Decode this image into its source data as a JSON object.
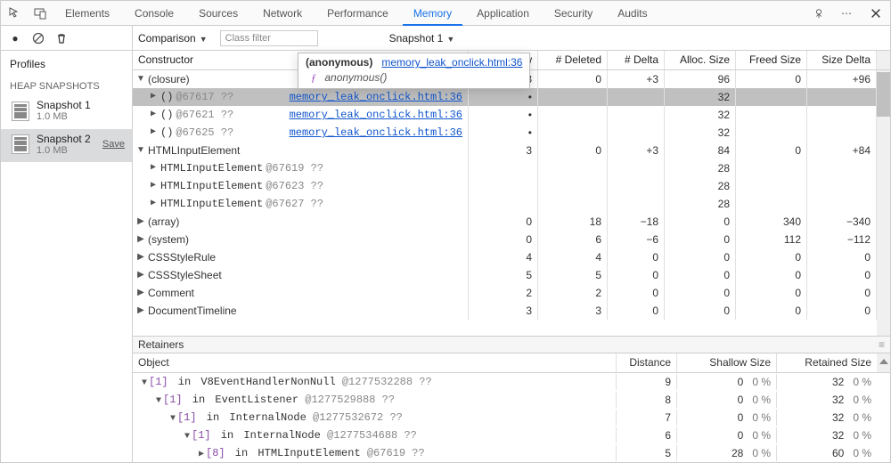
{
  "tabs": {
    "elements": "Elements",
    "console": "Console",
    "sources": "Sources",
    "network": "Network",
    "performance": "Performance",
    "memory": "Memory",
    "application": "Application",
    "security": "Security",
    "audits": "Audits"
  },
  "sidebar": {
    "profiles": "Profiles",
    "section": "HEAP SNAPSHOTS",
    "items": [
      {
        "name": "Snapshot 1",
        "size": "1.0 MB",
        "save": ""
      },
      {
        "name": "Snapshot 2",
        "size": "1.0 MB",
        "save": "Save"
      }
    ]
  },
  "filter": {
    "mode": "Comparison",
    "class_placeholder": "Class filter",
    "baseline": "Snapshot 1"
  },
  "headers": {
    "constructor": "Constructor",
    "new": "# New",
    "deleted": "# Deleted",
    "delta": "# Delta",
    "alloc": "Alloc. Size",
    "freed": "Freed Size",
    "sizedelta": "Size Delta"
  },
  "tooltip": {
    "name": "(anonymous)",
    "link": "memory_leak_onclick.html:36",
    "fn": "anonymous()"
  },
  "rows": [
    {
      "indent": 1,
      "open": true,
      "label": "(closure)",
      "addr": "",
      "rlink": "",
      "new": "3",
      "del": "0",
      "delta": "+3",
      "alloc": "96",
      "freed": "0",
      "sizedelta": "+96",
      "hl": false,
      "mono": false
    },
    {
      "indent": 2,
      "open": false,
      "label": "()",
      "addr": " @67617 ??",
      "rlink": "memory_leak_onclick.html:36",
      "new": "•",
      "del": "",
      "delta": "",
      "alloc": "32",
      "freed": "",
      "sizedelta": "",
      "hl": true,
      "mono": true
    },
    {
      "indent": 2,
      "open": false,
      "label": "()",
      "addr": " @67621 ??",
      "rlink": "memory_leak_onclick.html:36",
      "new": "•",
      "del": "",
      "delta": "",
      "alloc": "32",
      "freed": "",
      "sizedelta": "",
      "hl": false,
      "mono": true
    },
    {
      "indent": 2,
      "open": false,
      "label": "()",
      "addr": " @67625 ??",
      "rlink": "memory_leak_onclick.html:36",
      "new": "•",
      "del": "",
      "delta": "",
      "alloc": "32",
      "freed": "",
      "sizedelta": "",
      "hl": false,
      "mono": true
    },
    {
      "indent": 1,
      "open": true,
      "label": "HTMLInputElement",
      "addr": "",
      "rlink": "",
      "new": "3",
      "del": "0",
      "delta": "+3",
      "alloc": "84",
      "freed": "0",
      "sizedelta": "+84",
      "hl": false,
      "mono": false
    },
    {
      "indent": 2,
      "open": false,
      "label": "HTMLInputElement",
      "addr": " @67619 ??",
      "rlink": "",
      "new": "",
      "del": "",
      "delta": "",
      "alloc": "28",
      "freed": "",
      "sizedelta": "",
      "hl": false,
      "mono": true
    },
    {
      "indent": 2,
      "open": false,
      "label": "HTMLInputElement",
      "addr": " @67623 ??",
      "rlink": "",
      "new": "",
      "del": "",
      "delta": "",
      "alloc": "28",
      "freed": "",
      "sizedelta": "",
      "hl": false,
      "mono": true
    },
    {
      "indent": 2,
      "open": false,
      "label": "HTMLInputElement",
      "addr": " @67627 ??",
      "rlink": "",
      "new": "",
      "del": "",
      "delta": "",
      "alloc": "28",
      "freed": "",
      "sizedelta": "",
      "hl": false,
      "mono": true
    },
    {
      "indent": 1,
      "open": false,
      "label": "(array)",
      "addr": "",
      "rlink": "",
      "new": "0",
      "del": "18",
      "delta": "−18",
      "alloc": "0",
      "freed": "340",
      "sizedelta": "−340",
      "hl": false,
      "mono": false
    },
    {
      "indent": 1,
      "open": false,
      "label": "(system)",
      "addr": "",
      "rlink": "",
      "new": "0",
      "del": "6",
      "delta": "−6",
      "alloc": "0",
      "freed": "112",
      "sizedelta": "−112",
      "hl": false,
      "mono": false
    },
    {
      "indent": 1,
      "open": false,
      "label": "CSSStyleRule",
      "addr": "",
      "rlink": "",
      "new": "4",
      "del": "4",
      "delta": "0",
      "alloc": "0",
      "freed": "0",
      "sizedelta": "0",
      "hl": false,
      "mono": false
    },
    {
      "indent": 1,
      "open": false,
      "label": "CSSStyleSheet",
      "addr": "",
      "rlink": "",
      "new": "5",
      "del": "5",
      "delta": "0",
      "alloc": "0",
      "freed": "0",
      "sizedelta": "0",
      "hl": false,
      "mono": false
    },
    {
      "indent": 1,
      "open": false,
      "label": "Comment",
      "addr": "",
      "rlink": "",
      "new": "2",
      "del": "2",
      "delta": "0",
      "alloc": "0",
      "freed": "0",
      "sizedelta": "0",
      "hl": false,
      "mono": false
    },
    {
      "indent": 1,
      "open": false,
      "label": "DocumentTimeline",
      "addr": "",
      "rlink": "",
      "new": "3",
      "del": "3",
      "delta": "0",
      "alloc": "0",
      "freed": "0",
      "sizedelta": "0",
      "hl": false,
      "mono": false
    }
  ],
  "retainers": {
    "title": "Retainers",
    "headers": {
      "object": "Object",
      "distance": "Distance",
      "shallow": "Shallow Size",
      "retained": "Retained Size"
    },
    "rows": [
      {
        "indent": 0,
        "open": true,
        "pref": "[1]",
        "in": "in",
        "obj": "V8EventHandlerNonNull",
        "addr": " @1277532288 ??",
        "dist": "9",
        "sh": "0",
        "shp": "0 %",
        "ret": "32",
        "retp": "0 %"
      },
      {
        "indent": 1,
        "open": true,
        "pref": "[1]",
        "in": "in",
        "obj": "EventListener",
        "addr": " @1277529888 ??",
        "dist": "8",
        "sh": "0",
        "shp": "0 %",
        "ret": "32",
        "retp": "0 %"
      },
      {
        "indent": 2,
        "open": true,
        "pref": "[1]",
        "in": "in",
        "obj": "InternalNode",
        "addr": " @1277532672 ??",
        "dist": "7",
        "sh": "0",
        "shp": "0 %",
        "ret": "32",
        "retp": "0 %"
      },
      {
        "indent": 3,
        "open": true,
        "pref": "[1]",
        "in": "in",
        "obj": "InternalNode",
        "addr": " @1277534688 ??",
        "dist": "6",
        "sh": "0",
        "shp": "0 %",
        "ret": "32",
        "retp": "0 %"
      },
      {
        "indent": 4,
        "open": false,
        "pref": "[8]",
        "in": "in",
        "obj": "HTMLInputElement",
        "addr": " @67619 ??",
        "dist": "5",
        "sh": "28",
        "shp": "0 %",
        "ret": "60",
        "retp": "0 %"
      }
    ]
  }
}
